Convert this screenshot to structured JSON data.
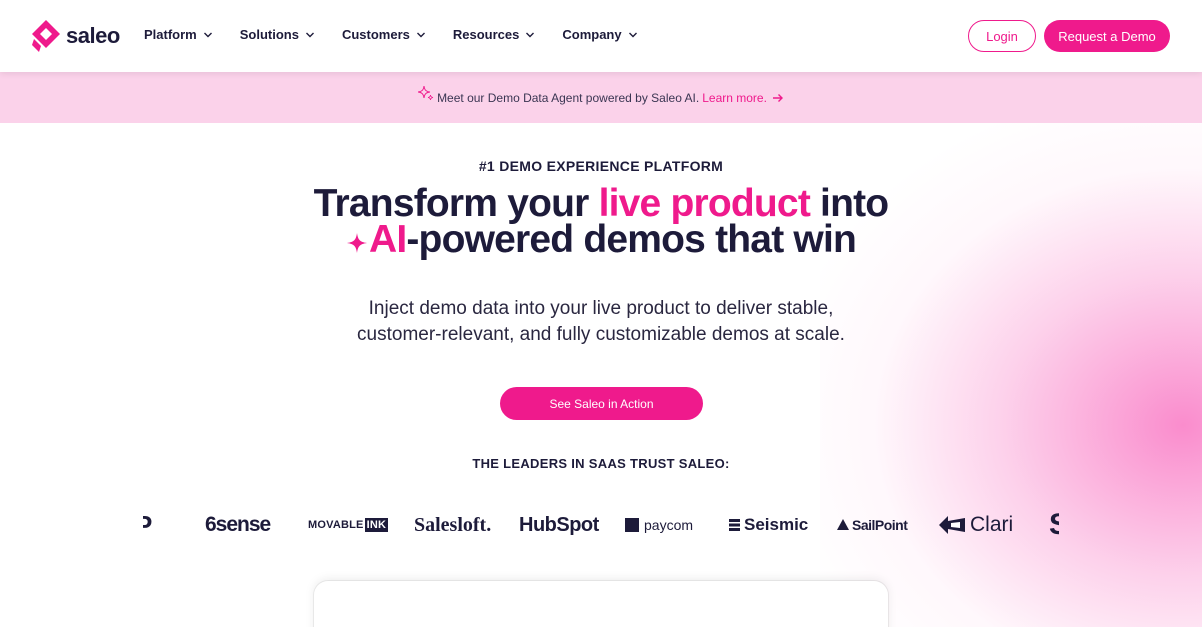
{
  "header": {
    "logo_text": "saleo",
    "nav": [
      {
        "label": "Platform"
      },
      {
        "label": "Solutions"
      },
      {
        "label": "Customers"
      },
      {
        "label": "Resources"
      },
      {
        "label": "Company"
      }
    ],
    "login_label": "Login",
    "demo_label": "Request a Demo"
  },
  "banner": {
    "text": "Meet our Demo Data Agent powered by Saleo AI.",
    "link": "Learn more."
  },
  "hero": {
    "eyebrow": "#1 DEMO EXPERIENCE PLATFORM",
    "headline_part1": "Transform your ",
    "headline_highlight1": "live product",
    "headline_part2": " into",
    "headline_highlight2": "AI",
    "headline_part3": "-powered demos that win",
    "subhead_line1": "Inject demo data into your live product to deliver stable,",
    "subhead_line2": "customer-relevant, and fully customizable demos at scale.",
    "cta_label": "See Saleo in Action",
    "trust_label": "THE LEADERS IN SAAS TRUST SALEO:"
  },
  "logos": {
    "partial_left": "P",
    "sense": "6sense",
    "movable": "MOVABLE",
    "movable_ink": "INK",
    "salesloft": "Salesloft.",
    "hubspot": "HubSpot",
    "paycom": "paycom",
    "seismic": "Seismic",
    "sailpoint": "SailPoint",
    "clari": "Clari",
    "partial_right": "S"
  },
  "colors": {
    "brand_pink": "#ef1a8c",
    "navy": "#1d1b3a",
    "banner_bg": "#fbd2ea"
  },
  "icons": {
    "logo": "saleo-diamond-icon",
    "chevron": "chevron-down-icon",
    "sparkle": "sparkle-icon",
    "arrow": "arrow-right-icon",
    "star": "four-point-star-icon"
  }
}
